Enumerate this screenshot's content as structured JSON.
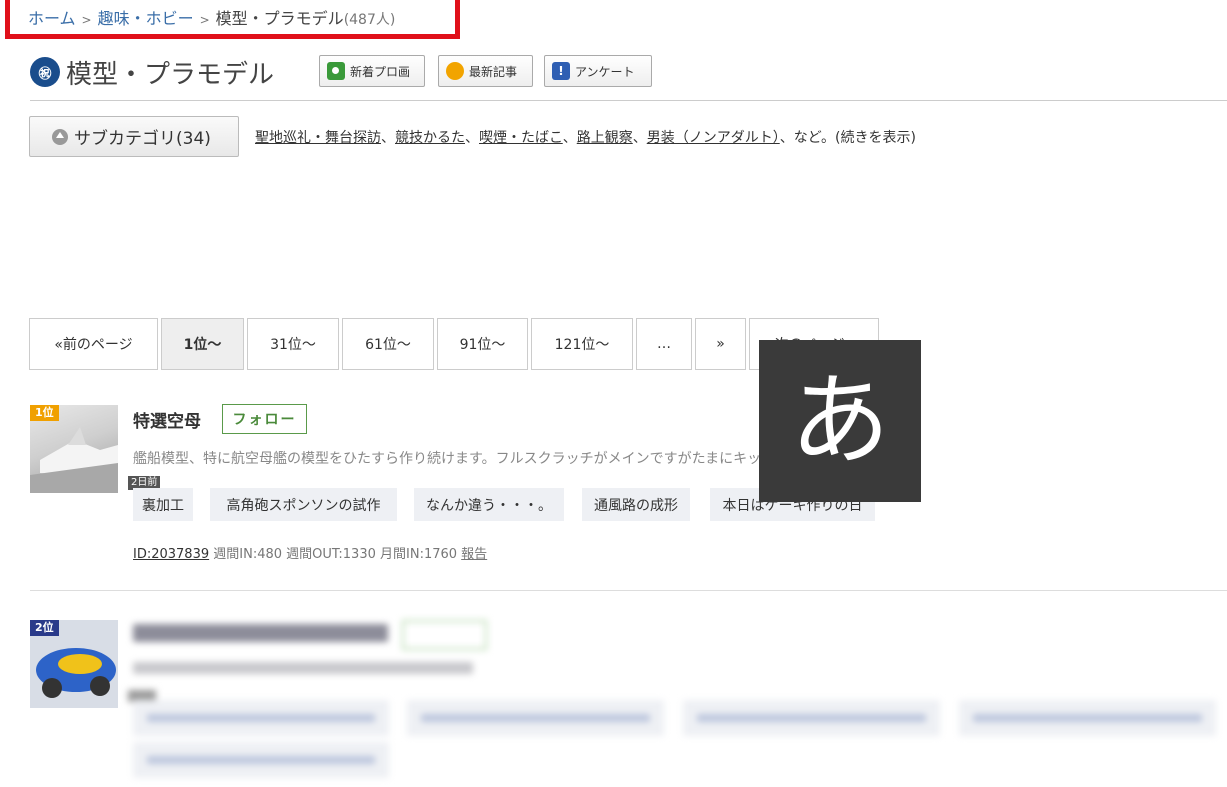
{
  "breadcrumb": {
    "home": "ホーム",
    "sep": ">",
    "parent": "趣味・ホビー",
    "current": "模型・プラモデル",
    "count": "(487人)"
  },
  "category": {
    "icon_text": "㊗",
    "title": "模型・プラモデル",
    "buttons": [
      {
        "label": "新着プロ画",
        "icon": "camera-icon"
      },
      {
        "label": "最新記事",
        "icon": "new-badge-icon"
      },
      {
        "label": "アンケート",
        "icon": "survey-icon"
      }
    ]
  },
  "subcategory": {
    "button_label": "サブカテゴリ(34)",
    "links": [
      "聖地巡礼・舞台探訪",
      "競技かるた",
      "喫煙・たばこ",
      "路上観察",
      "男装（ノンアダルト）"
    ],
    "comma": "、",
    "suffix": "、など。(続きを表示)"
  },
  "pagination": [
    "«前のページ",
    "1位～",
    "31位～",
    "61位～",
    "91位～",
    "121位～",
    "…",
    "»",
    "次のページ»"
  ],
  "ime_indicator": "あ",
  "rankings": [
    {
      "rank": "1位",
      "updated": "2日前",
      "title": "特選空母",
      "follow": "フォロー",
      "description": "艦船模型、特に航空母艦の模型をひたすら作り続けます。フルスクラッチがメインですがたまにキットも作ります。",
      "tags": [
        "裏加工",
        "高角砲スポンソンの試作",
        "なんか違う・・・。",
        "通風路の成形",
        "本日はケーキ作りの日"
      ],
      "id": "ID:2037839",
      "stats": "週間IN:480 週間OUT:1330 月間IN:1760",
      "report": "報告"
    },
    {
      "rank": "2位"
    }
  ],
  "colors": {
    "breadcrumb_highlight": "#e0101a",
    "link": "#3a6ea8",
    "rank1": "#f0a000",
    "rank2": "#2a3a8a",
    "follow": "#4a8a3a"
  }
}
